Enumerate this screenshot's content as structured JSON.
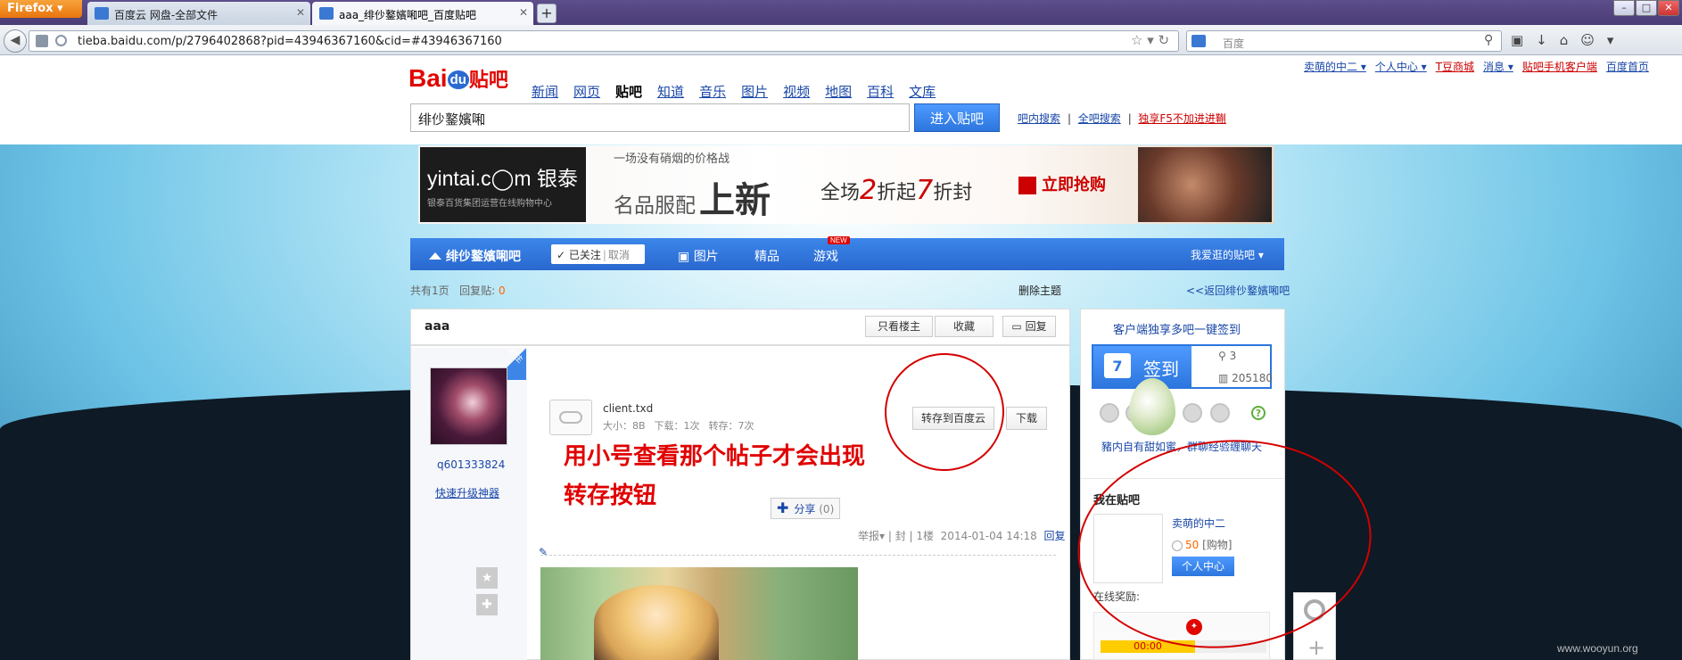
{
  "browser": {
    "menu_label": "Firefox",
    "tabs": [
      {
        "title": "百度云 网盘-全部文件"
      },
      {
        "title": "aaa_绯仯鐜嬪啝吧_百度贴吧"
      }
    ],
    "new_tab": "+",
    "url": "tieba.baidu.com/p/2796402868?pid=43946367160&cid=#43946367160",
    "search_placeholder": "百度"
  },
  "tieba": {
    "logo": {
      "bai": "Bai",
      "du": "du",
      "tieba": "贴吧"
    },
    "nav": [
      "新闻",
      "网页",
      "贴吧",
      "知道",
      "音乐",
      "图片",
      "视频",
      "地图",
      "百科",
      "文库"
    ],
    "nav_current": "贴吧",
    "user_links": [
      "卖萌的中二 ▾",
      "个人中心 ▾",
      "T豆商城",
      "消息 ▾",
      "贴吧手机客户端",
      "百度首页"
    ],
    "search_value": "绯仯鐜嬪啝",
    "enter_button": "进入贴吧",
    "search_links": [
      "吧内搜索",
      "全吧搜索"
    ],
    "search_promo": "独享F5不加进进鞩"
  },
  "banner": {
    "brand": "yintai.c◯m 银泰",
    "brand_sub": "银泰百货集团运营在线购物中心",
    "line1": "一场没有硝烟的价格战",
    "line2_a": "名品服配",
    "line2_b": "上新",
    "promo_a": "全场",
    "promo_num1": "2",
    "promo_b": "折起",
    "promo_num2": "7",
    "promo_c": "折封",
    "cta": "立即抢购"
  },
  "forum_nav": {
    "forum_name": "绯仯鐜嬪啝吧",
    "followed": "✓ 已关注",
    "cancel": "取消",
    "pictures": "图片",
    "featured": "精品",
    "games": "游戏",
    "new_badge": "NEW",
    "favorite_bars": "我爱逛的贴吧 ▾"
  },
  "meta": {
    "pages_label": "共有",
    "pages_count": "1",
    "pages_unit": "页",
    "replies_label": "回复贴:",
    "replies_count": "0",
    "delete_topic": "删除主题",
    "back_link": "<<返回绯仯鐜嬪啝吧"
  },
  "post": {
    "title": "aaa",
    "only_owner": "只看楼主",
    "collect": "收藏",
    "reply": "回复",
    "owner_tag": "楼主",
    "username": "q601333824",
    "upgrade": "快速升级神器",
    "file_name": "client.txd",
    "file_size": "大小：8B",
    "file_downloads": "下载：1次",
    "file_saves": "转存：7次",
    "save_to_cloud": "转存到百度云",
    "download": "下载",
    "annotation": "用小号查看那个帖子才会出现转存按钮",
    "share_label": "分享",
    "share_count": "(0)",
    "report": "举报▾",
    "block": "封",
    "floor": "1楼",
    "datetime": "2014-01-04 14:18",
    "reply_link": "回复"
  },
  "sidebar": {
    "title": "客户端独享多吧一键签到",
    "sign_label": "签到",
    "calendar_day": "7",
    "sign_count": "3",
    "sign_total": "205180",
    "note": "豬内自有甜如蜜，群聊经验缠聊天",
    "my_bars_title": "我在贴吧",
    "my_name": "卖萌的中二",
    "coins": "50",
    "coins_label": "[购物]",
    "user_center": "个人中心",
    "online_reward": "在线奖励:",
    "timer": "00:00",
    "help": "?"
  },
  "watermark": "www.wooyun.org"
}
